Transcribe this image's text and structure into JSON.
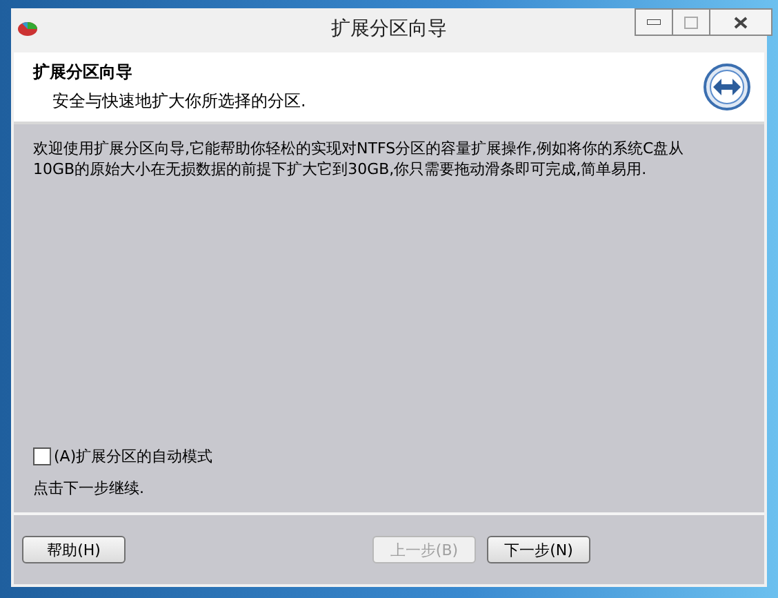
{
  "window": {
    "title": "扩展分区向导"
  },
  "header": {
    "title": "扩展分区向导",
    "subtitle": "安全与快速地扩大你所选择的分区."
  },
  "intro": "欢迎使用扩展分区向导,它能帮助你轻松的实现对NTFS分区的容量扩展操作,例如将你的系统C盘从10GB的原始大小在无损数据的前提下扩大它到30GB,你只需要拖动滑条即可完成,简单易用.",
  "auto_mode": {
    "label": "(A)扩展分区的自动模式",
    "checked": false
  },
  "hint": "点击下一步继续.",
  "buttons": [
    {
      "label": "帮助(H)",
      "kind": "help",
      "disabled": false
    },
    {
      "label": "上一步(B)",
      "kind": "nav",
      "disabled": true
    },
    {
      "label": "下一步(N)",
      "kind": "nav",
      "disabled": false
    }
  ]
}
